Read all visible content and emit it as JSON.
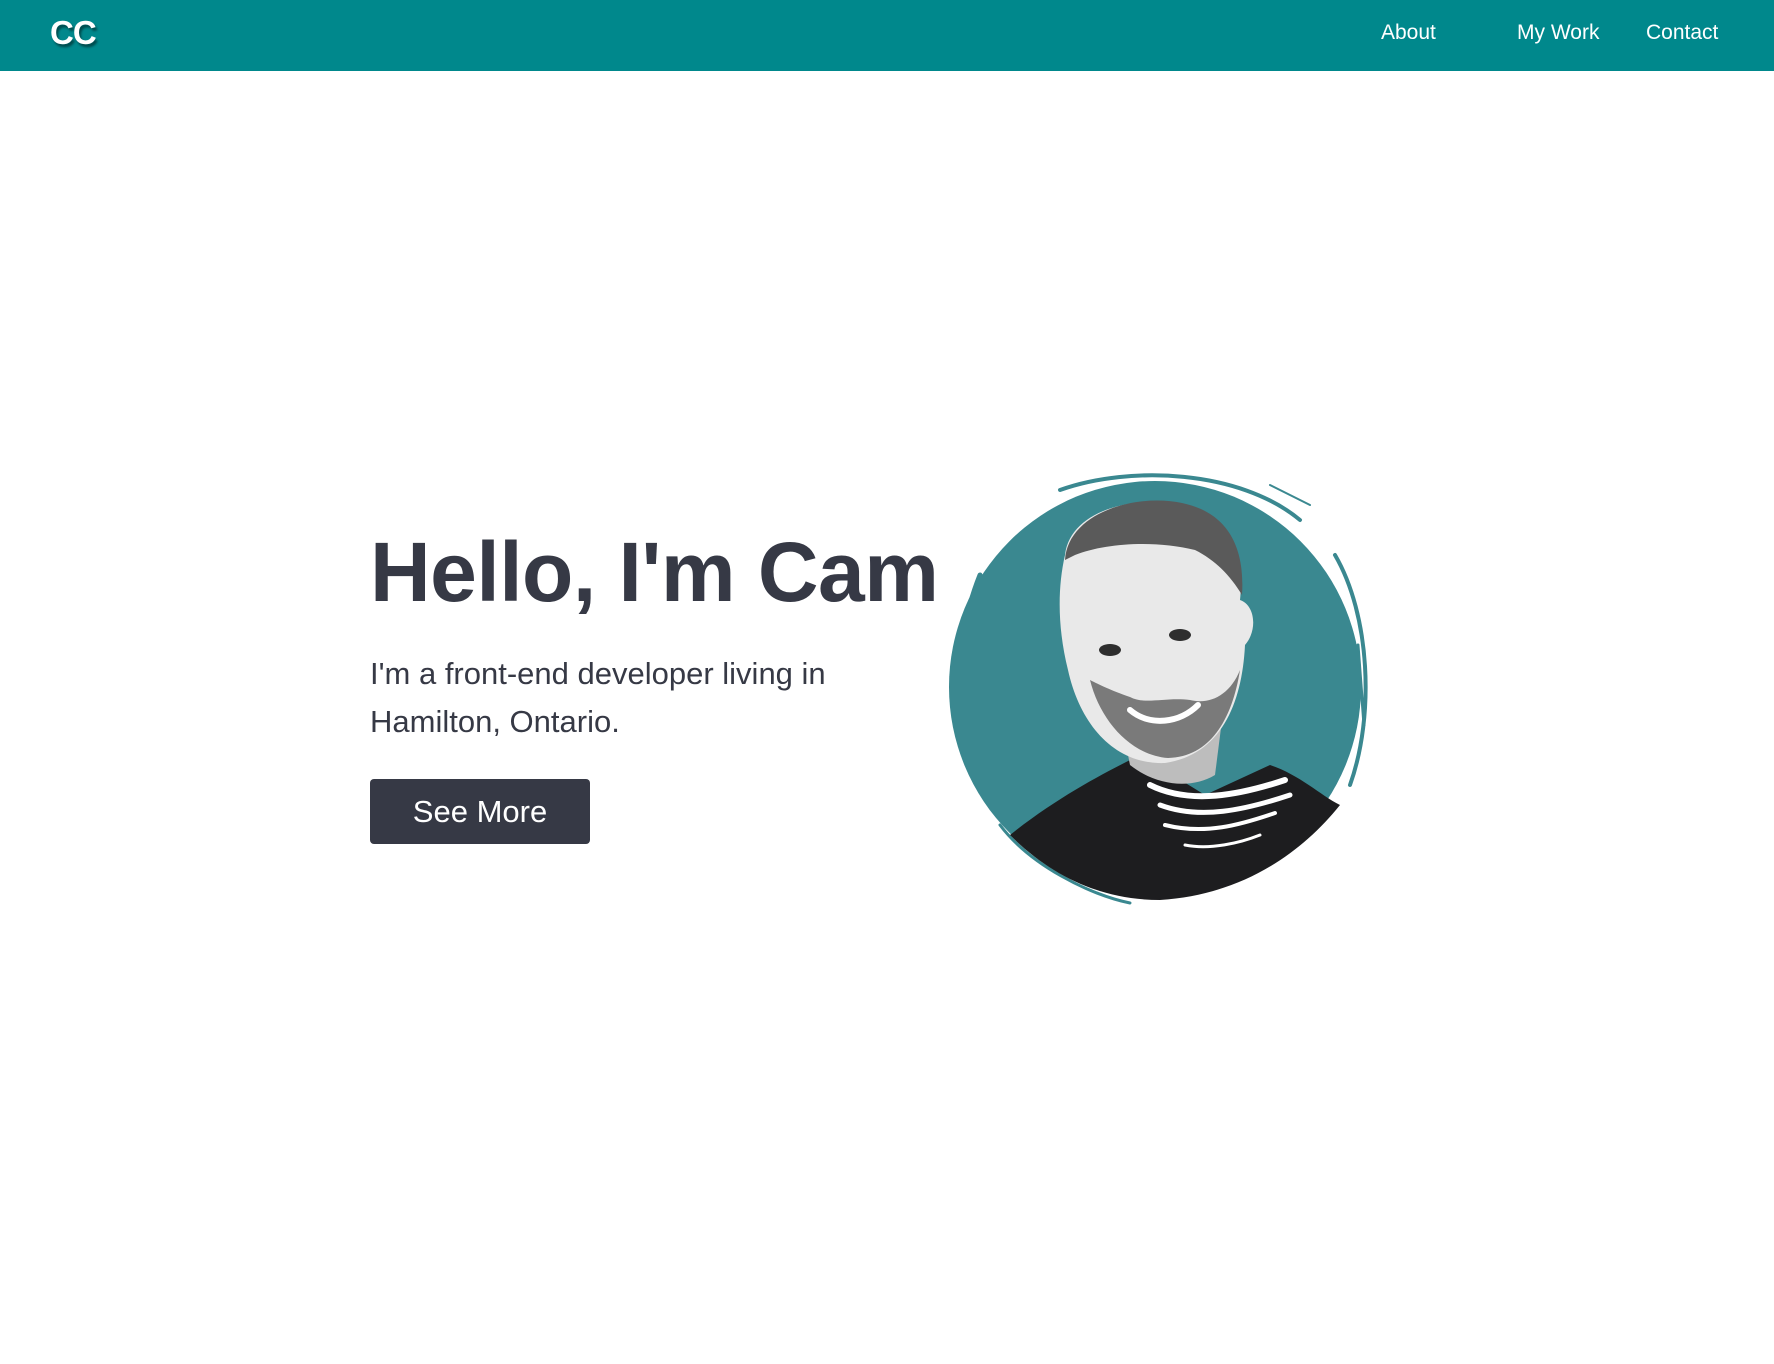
{
  "header": {
    "logo": "CC",
    "nav": [
      {
        "label": "About"
      },
      {
        "label": "My Work"
      },
      {
        "label": "Contact"
      }
    ]
  },
  "hero": {
    "title": "Hello, I'm Cam",
    "subtitle": "I'm a front-end developer living in Hamilton, Ontario.",
    "button_label": "See More",
    "portrait_alt": "Portrait of Cam"
  },
  "colors": {
    "nav_background": "#00888c",
    "text_dark": "#363945",
    "portrait_circle": "#3a8890",
    "button_background": "#363945"
  }
}
